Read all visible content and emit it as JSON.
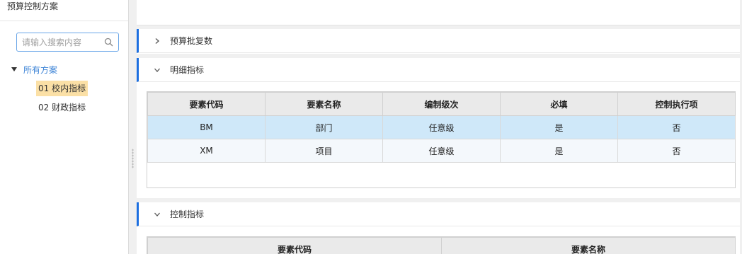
{
  "left_panel": {
    "title": "预算控制方案",
    "search": {
      "placeholder": "请输入搜索内容",
      "value": ""
    },
    "tree": {
      "root": "所有方案",
      "items": [
        {
          "label": "01 校内指标",
          "selected": true
        },
        {
          "label": "02 财政指标",
          "selected": false
        }
      ]
    }
  },
  "sections": {
    "approval": {
      "title": "预算批复数",
      "expanded": false
    },
    "detail": {
      "title": "明细指标",
      "expanded": true,
      "columns": [
        "要素代码",
        "要素名称",
        "编制级次",
        "必填",
        "控制执行项"
      ],
      "rows": [
        [
          "BM",
          "部门",
          "任意级",
          "是",
          "否"
        ],
        [
          "XM",
          "项目",
          "任意级",
          "是",
          "否"
        ]
      ]
    },
    "control": {
      "title": "控制指标",
      "expanded": true,
      "columns": [
        "要素代码",
        "要素名称"
      ]
    }
  },
  "colors": {
    "accent": "#1c6fe0",
    "selected_row": "#cfe8f9",
    "selected_node": "#fbe0a6",
    "tree_root": "#3a82d6"
  },
  "icons": {
    "search": "search-icon",
    "collapsed": "chevron-right-icon",
    "expanded": "chevron-down-icon",
    "tree_expand": "caret-down-icon"
  }
}
